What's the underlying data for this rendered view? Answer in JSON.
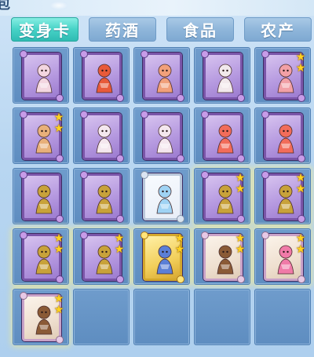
{
  "panel": {
    "title": "包"
  },
  "tabs": [
    {
      "label": "变身卡",
      "active": true
    },
    {
      "label": "药酒",
      "active": false
    },
    {
      "label": "食品",
      "active": false
    },
    {
      "label": "农产",
      "active": false
    }
  ],
  "colors": {
    "tab_active": "#46d2c6",
    "tab_inactive": "#8fb6da",
    "slot": "#5e8dc0",
    "card_purple": "#b69ae0",
    "card_gold": "#f2cf5b",
    "star": "#ffd21f"
  },
  "inventory": {
    "rows": [
      [
        {
          "item": "rabbit-character-card",
          "frame": "purple",
          "stars": 0,
          "glow": false,
          "hue": "#f3d6e0"
        },
        {
          "item": "red-lion-dancer-card",
          "frame": "purple",
          "stars": 0,
          "glow": false,
          "hue": "#e85a3a"
        },
        {
          "item": "fox-girl-card",
          "frame": "purple",
          "stars": 0,
          "glow": false,
          "hue": "#f1a07a"
        },
        {
          "item": "white-cow-card",
          "frame": "purple",
          "stars": 0,
          "glow": false,
          "hue": "#f2e9ec"
        },
        {
          "item": "pig-card",
          "frame": "purple",
          "stars": 2,
          "glow": false,
          "hue": "#f2a0a6"
        }
      ],
      [
        {
          "item": "monkey-card",
          "frame": "purple",
          "stars": 2,
          "glow": false,
          "hue": "#e8b07a"
        },
        {
          "item": "white-dancer-card",
          "frame": "purple",
          "stars": 0,
          "glow": false,
          "hue": "#f4e7ee"
        },
        {
          "item": "white-dancer-card",
          "frame": "purple",
          "stars": 0,
          "glow": false,
          "hue": "#f4e7ee"
        },
        {
          "item": "phoenix-card",
          "frame": "purple",
          "stars": 0,
          "glow": false,
          "hue": "#f26c5a"
        },
        {
          "item": "phoenix-card",
          "frame": "purple",
          "stars": 0,
          "glow": false,
          "hue": "#f26c5a"
        }
      ],
      [
        {
          "item": "golden-warrior-card",
          "frame": "purple",
          "stars": 0,
          "glow": false,
          "hue": "#c8a23a"
        },
        {
          "item": "golden-warrior-card",
          "frame": "purple",
          "stars": 0,
          "glow": false,
          "hue": "#c8a23a"
        },
        {
          "item": "ice-dragon-card",
          "frame": "ice",
          "stars": 0,
          "glow": false,
          "hue": "#9fd3f4"
        },
        {
          "item": "golden-warrior-card",
          "frame": "purple",
          "stars": 2,
          "glow": true,
          "hue": "#c8a23a"
        },
        {
          "item": "golden-warrior-card",
          "frame": "purple",
          "stars": 2,
          "glow": true,
          "hue": "#c8a23a"
        }
      ],
      [
        {
          "item": "golden-warrior-card",
          "frame": "purple",
          "stars": 2,
          "glow": true,
          "hue": "#c8a23a"
        },
        {
          "item": "golden-warrior-card",
          "frame": "purple",
          "stars": 2,
          "glow": true,
          "hue": "#c8a23a"
        },
        {
          "item": "blue-maiden-card",
          "frame": "gold",
          "stars": 2,
          "glow": true,
          "hue": "#5b7fd6"
        },
        {
          "item": "brown-bear-card",
          "frame": "cream",
          "stars": 2,
          "glow": true,
          "hue": "#8a5a36"
        },
        {
          "item": "pink-girl-card",
          "frame": "cream",
          "stars": 2,
          "glow": true,
          "hue": "#f07aa8"
        }
      ],
      [
        {
          "item": "brown-bear-card",
          "frame": "cream",
          "stars": 2,
          "glow": true,
          "hue": "#8a5a36"
        },
        {
          "item": "empty-slot",
          "frame": "none",
          "stars": 0,
          "glow": false,
          "hue": ""
        },
        {
          "item": "empty-slot",
          "frame": "none",
          "stars": 0,
          "glow": false,
          "hue": ""
        },
        {
          "item": "empty-slot",
          "frame": "none",
          "stars": 0,
          "glow": false,
          "hue": ""
        },
        {
          "item": "empty-slot",
          "frame": "none",
          "stars": 0,
          "glow": false,
          "hue": ""
        }
      ]
    ]
  }
}
